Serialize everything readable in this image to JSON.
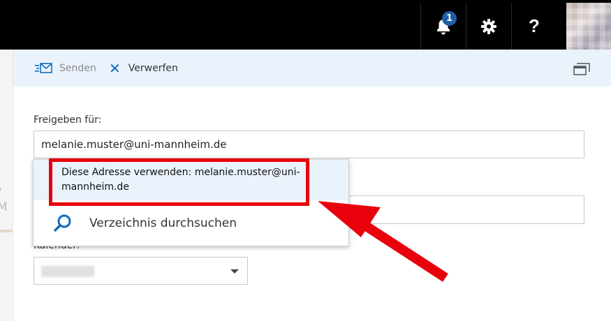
{
  "topbar": {
    "notification_count": "1",
    "notification_icon": "bell-icon",
    "settings_icon": "gear-icon",
    "help_glyph": "?"
  },
  "toolbar": {
    "send_label": "Senden",
    "discard_label": "Verwerfen",
    "discard_glyph": "✕",
    "popout_icon": "popout-icon"
  },
  "form": {
    "share_label": "Freigeben für:",
    "share_value": "melanie.muster@uni-mannheim.de",
    "calendar_label": "Kalender:"
  },
  "dropdown": {
    "suggestion": "Diese Adresse verwenden: melanie.muster@uni-mannheim.de",
    "search_directory": "Verzeichnis durchsuchen"
  },
  "colors": {
    "accent": "#0f6cbd",
    "highlight": "#e8000b",
    "topbar": "#000000",
    "toolbar_bg": "#eaf3fc"
  }
}
